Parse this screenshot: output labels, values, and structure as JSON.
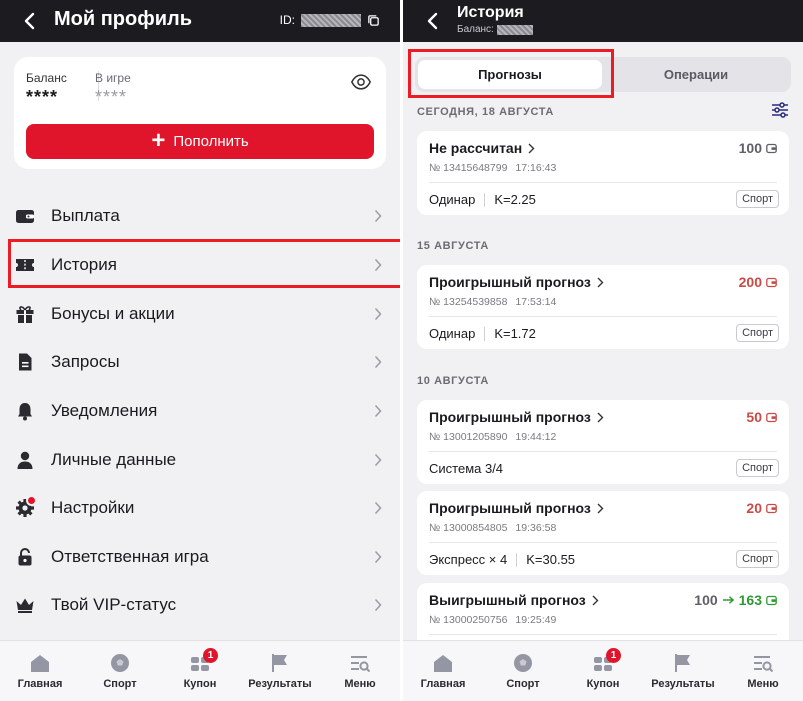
{
  "profile": {
    "title": "Мой профиль",
    "id_label": "ID:",
    "balance_label": "Баланс",
    "balance_value": "****",
    "in_game_label": "В игре",
    "in_game_value": "****",
    "topup_label": "Пополнить",
    "menu": [
      {
        "label": "Выплата",
        "icon": "wallet-icon"
      },
      {
        "label": "История",
        "icon": "ticket-icon"
      },
      {
        "label": "Бонусы и акции",
        "icon": "gift-icon"
      },
      {
        "label": "Запросы",
        "icon": "document-icon"
      },
      {
        "label": "Уведомления",
        "icon": "bell-icon"
      },
      {
        "label": "Личные данные",
        "icon": "person-icon"
      },
      {
        "label": "Настройки",
        "icon": "gear-icon"
      },
      {
        "label": "Ответственная игра",
        "icon": "lock-icon"
      },
      {
        "label": "Твой VIP-статус",
        "icon": "crown-icon"
      }
    ]
  },
  "history": {
    "title": "История",
    "balance_label": "Баланс:",
    "tabs": [
      "Прогнозы",
      "Операции"
    ],
    "active_tab": "Прогнозы",
    "groups": [
      {
        "date": "СЕГОДНЯ, 18 АВГУСТА",
        "bets": [
          {
            "status": "Не рассчитан",
            "number": "№ 13415648799",
            "time": "17:16:43",
            "amount": "100",
            "payout": "",
            "result": "pending",
            "kind": "Одинар",
            "coef": "K=2.25",
            "chip": "Спорт"
          }
        ]
      },
      {
        "date": "15 АВГУСТА",
        "bets": [
          {
            "status": "Проигрышный прогноз",
            "number": "№ 13254539858",
            "time": "17:53:14",
            "amount": "200",
            "payout": "",
            "result": "lost",
            "kind": "Одинар",
            "coef": "K=1.72",
            "chip": "Спорт"
          }
        ]
      },
      {
        "date": "10 АВГУСТА",
        "bets": [
          {
            "status": "Проигрышный прогноз",
            "number": "№ 13001205890",
            "time": "19:44:12",
            "amount": "50",
            "payout": "",
            "result": "lost",
            "kind": "Система 3/4",
            "coef": "",
            "chip": "Спорт"
          },
          {
            "status": "Проигрышный прогноз",
            "number": "№ 13000854805",
            "time": "19:36:58",
            "amount": "20",
            "payout": "",
            "result": "lost",
            "kind": "Экспресс × 4",
            "coef": "K=30.55",
            "chip": "Спорт"
          },
          {
            "status": "Выигрышный прогноз",
            "number": "№ 13000250756",
            "time": "19:25:49",
            "amount": "100",
            "payout": "163",
            "result": "won",
            "kind": "",
            "coef": "",
            "chip": ""
          }
        ]
      }
    ]
  },
  "tabbar": {
    "items": [
      {
        "label": "Главная",
        "icon": "home-icon"
      },
      {
        "label": "Спорт",
        "icon": "ball-icon"
      },
      {
        "label": "Купон",
        "icon": "coupon-icon",
        "badge": "1"
      },
      {
        "label": "Результаты",
        "icon": "flag-icon"
      },
      {
        "label": "Меню",
        "icon": "menu-search-icon"
      }
    ]
  },
  "colors": {
    "accent": "#e0152b",
    "highlight": "#ec1c24",
    "header": "#1b1b20",
    "lost": "#c94a46",
    "won": "#2f9a33"
  }
}
